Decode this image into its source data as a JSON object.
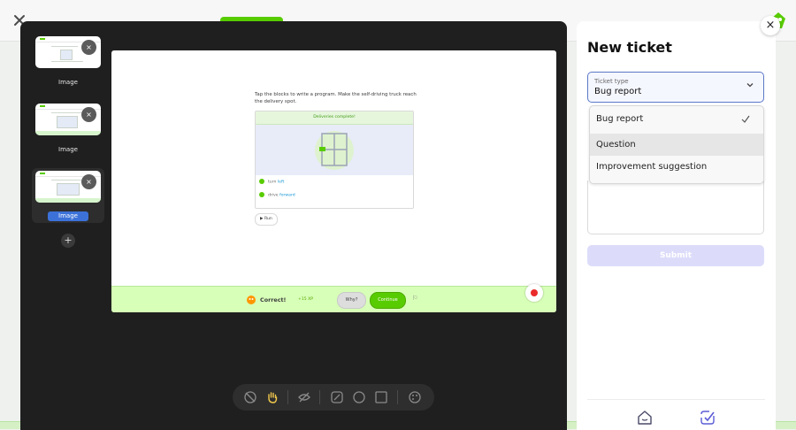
{
  "background": {
    "colors": {
      "brand_green": "#58cc02",
      "page": "#eef1ee"
    }
  },
  "editor": {
    "thumbnails": [
      {
        "label": "Image",
        "remove_label": "×"
      },
      {
        "label": "Image",
        "remove_label": "×"
      },
      {
        "label": "Image",
        "remove_label": "×",
        "selected": true
      }
    ],
    "add_label": "+",
    "screenshot": {
      "instructions": "Tap the blocks to write a program. Make the self-driving truck reach the delivery spot.",
      "banner": "Deliveries complete!",
      "commands": [
        {
          "verb": "turn",
          "arg": "left"
        },
        {
          "verb": "drive",
          "arg": "forward"
        }
      ],
      "run_label": "Run",
      "result": "Correct!",
      "xp": "+15 XP",
      "why_label": "Why?",
      "continue_label": "Continue"
    },
    "tools": [
      "hide-icon",
      "hand-icon",
      "eye-off-icon",
      "pen-icon",
      "circle-icon",
      "square-icon",
      "palette-icon"
    ],
    "active_tool": "hand-icon"
  },
  "ticket": {
    "title": "New ticket",
    "close_label": "×",
    "field_label": "Ticket type",
    "selected_value": "Bug report",
    "options": [
      {
        "label": "Bug report",
        "checked": true
      },
      {
        "label": "Question",
        "hovered": true
      },
      {
        "label": "Improvement suggestion"
      }
    ],
    "submit_label": "Submit",
    "footer_icons": [
      "home-icon",
      "ticket-check-icon"
    ],
    "colors": {
      "accent": "#5b5bd6",
      "submit_disabled": "#dcdcfa"
    }
  }
}
